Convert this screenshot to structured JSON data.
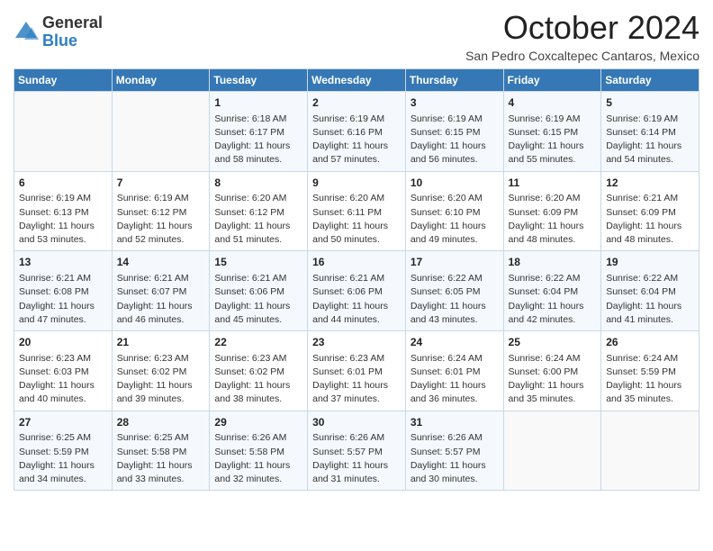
{
  "logo": {
    "general": "General",
    "blue": "Blue"
  },
  "header": {
    "month": "October 2024",
    "location": "San Pedro Coxcaltepec Cantaros, Mexico"
  },
  "weekdays": [
    "Sunday",
    "Monday",
    "Tuesday",
    "Wednesday",
    "Thursday",
    "Friday",
    "Saturday"
  ],
  "weeks": [
    [
      {
        "day": "",
        "info": ""
      },
      {
        "day": "",
        "info": ""
      },
      {
        "day": "1",
        "info": "Sunrise: 6:18 AM\nSunset: 6:17 PM\nDaylight: 11 hours and 58 minutes."
      },
      {
        "day": "2",
        "info": "Sunrise: 6:19 AM\nSunset: 6:16 PM\nDaylight: 11 hours and 57 minutes."
      },
      {
        "day": "3",
        "info": "Sunrise: 6:19 AM\nSunset: 6:15 PM\nDaylight: 11 hours and 56 minutes."
      },
      {
        "day": "4",
        "info": "Sunrise: 6:19 AM\nSunset: 6:15 PM\nDaylight: 11 hours and 55 minutes."
      },
      {
        "day": "5",
        "info": "Sunrise: 6:19 AM\nSunset: 6:14 PM\nDaylight: 11 hours and 54 minutes."
      }
    ],
    [
      {
        "day": "6",
        "info": "Sunrise: 6:19 AM\nSunset: 6:13 PM\nDaylight: 11 hours and 53 minutes."
      },
      {
        "day": "7",
        "info": "Sunrise: 6:19 AM\nSunset: 6:12 PM\nDaylight: 11 hours and 52 minutes."
      },
      {
        "day": "8",
        "info": "Sunrise: 6:20 AM\nSunset: 6:12 PM\nDaylight: 11 hours and 51 minutes."
      },
      {
        "day": "9",
        "info": "Sunrise: 6:20 AM\nSunset: 6:11 PM\nDaylight: 11 hours and 50 minutes."
      },
      {
        "day": "10",
        "info": "Sunrise: 6:20 AM\nSunset: 6:10 PM\nDaylight: 11 hours and 49 minutes."
      },
      {
        "day": "11",
        "info": "Sunrise: 6:20 AM\nSunset: 6:09 PM\nDaylight: 11 hours and 48 minutes."
      },
      {
        "day": "12",
        "info": "Sunrise: 6:21 AM\nSunset: 6:09 PM\nDaylight: 11 hours and 48 minutes."
      }
    ],
    [
      {
        "day": "13",
        "info": "Sunrise: 6:21 AM\nSunset: 6:08 PM\nDaylight: 11 hours and 47 minutes."
      },
      {
        "day": "14",
        "info": "Sunrise: 6:21 AM\nSunset: 6:07 PM\nDaylight: 11 hours and 46 minutes."
      },
      {
        "day": "15",
        "info": "Sunrise: 6:21 AM\nSunset: 6:06 PM\nDaylight: 11 hours and 45 minutes."
      },
      {
        "day": "16",
        "info": "Sunrise: 6:21 AM\nSunset: 6:06 PM\nDaylight: 11 hours and 44 minutes."
      },
      {
        "day": "17",
        "info": "Sunrise: 6:22 AM\nSunset: 6:05 PM\nDaylight: 11 hours and 43 minutes."
      },
      {
        "day": "18",
        "info": "Sunrise: 6:22 AM\nSunset: 6:04 PM\nDaylight: 11 hours and 42 minutes."
      },
      {
        "day": "19",
        "info": "Sunrise: 6:22 AM\nSunset: 6:04 PM\nDaylight: 11 hours and 41 minutes."
      }
    ],
    [
      {
        "day": "20",
        "info": "Sunrise: 6:23 AM\nSunset: 6:03 PM\nDaylight: 11 hours and 40 minutes."
      },
      {
        "day": "21",
        "info": "Sunrise: 6:23 AM\nSunset: 6:02 PM\nDaylight: 11 hours and 39 minutes."
      },
      {
        "day": "22",
        "info": "Sunrise: 6:23 AM\nSunset: 6:02 PM\nDaylight: 11 hours and 38 minutes."
      },
      {
        "day": "23",
        "info": "Sunrise: 6:23 AM\nSunset: 6:01 PM\nDaylight: 11 hours and 37 minutes."
      },
      {
        "day": "24",
        "info": "Sunrise: 6:24 AM\nSunset: 6:01 PM\nDaylight: 11 hours and 36 minutes."
      },
      {
        "day": "25",
        "info": "Sunrise: 6:24 AM\nSunset: 6:00 PM\nDaylight: 11 hours and 35 minutes."
      },
      {
        "day": "26",
        "info": "Sunrise: 6:24 AM\nSunset: 5:59 PM\nDaylight: 11 hours and 35 minutes."
      }
    ],
    [
      {
        "day": "27",
        "info": "Sunrise: 6:25 AM\nSunset: 5:59 PM\nDaylight: 11 hours and 34 minutes."
      },
      {
        "day": "28",
        "info": "Sunrise: 6:25 AM\nSunset: 5:58 PM\nDaylight: 11 hours and 33 minutes."
      },
      {
        "day": "29",
        "info": "Sunrise: 6:26 AM\nSunset: 5:58 PM\nDaylight: 11 hours and 32 minutes."
      },
      {
        "day": "30",
        "info": "Sunrise: 6:26 AM\nSunset: 5:57 PM\nDaylight: 11 hours and 31 minutes."
      },
      {
        "day": "31",
        "info": "Sunrise: 6:26 AM\nSunset: 5:57 PM\nDaylight: 11 hours and 30 minutes."
      },
      {
        "day": "",
        "info": ""
      },
      {
        "day": "",
        "info": ""
      }
    ]
  ]
}
